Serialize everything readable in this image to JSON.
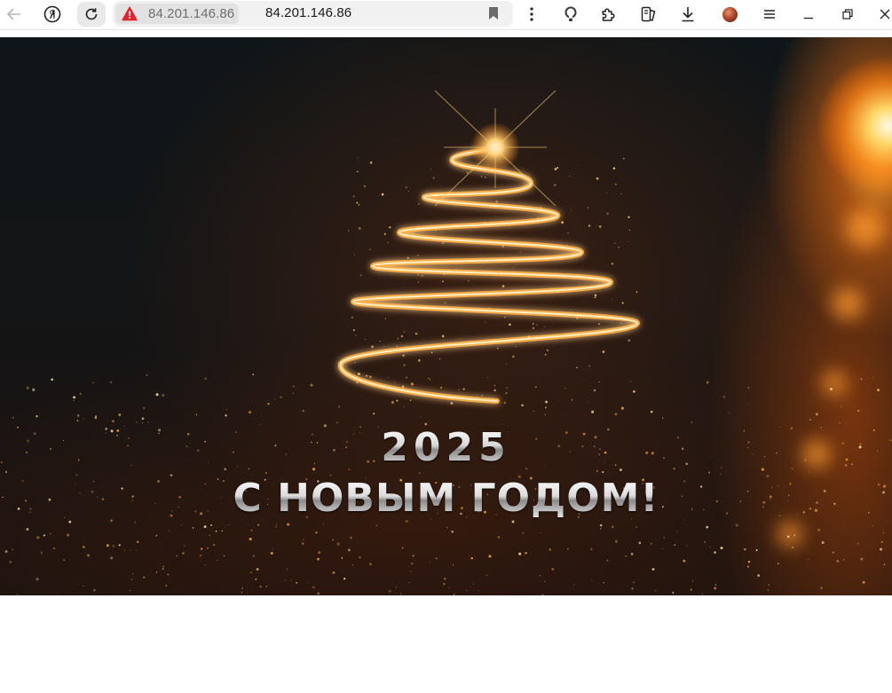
{
  "browser": {
    "omnibox": {
      "security_host": "84.201.146.86",
      "url": "84.201.146.86"
    },
    "colors": {
      "warning": "#e3242b",
      "toolbar_bg": "#ffffff",
      "omnibox_bg": "#f1f1f1"
    },
    "icons": {
      "back": "arrow-left",
      "yandex": "yandex-logo",
      "reload": "reload",
      "security": "warning-triangle",
      "bookmark": "bookmark",
      "menu": "vertical-dots",
      "privacy": "shield-lightbulb",
      "extensions": "puzzle",
      "collections": "collections",
      "downloads": "download-arrow",
      "profile": "avatar",
      "settings": "hamburger",
      "minimize": "minimize",
      "restore": "restore",
      "close": "close-x"
    }
  },
  "page": {
    "hero": {
      "year": "2025",
      "greeting": "С НОВЫМ ГОДОМ!",
      "colors": {
        "glow": "#ffb347",
        "background": "#121517"
      }
    }
  }
}
